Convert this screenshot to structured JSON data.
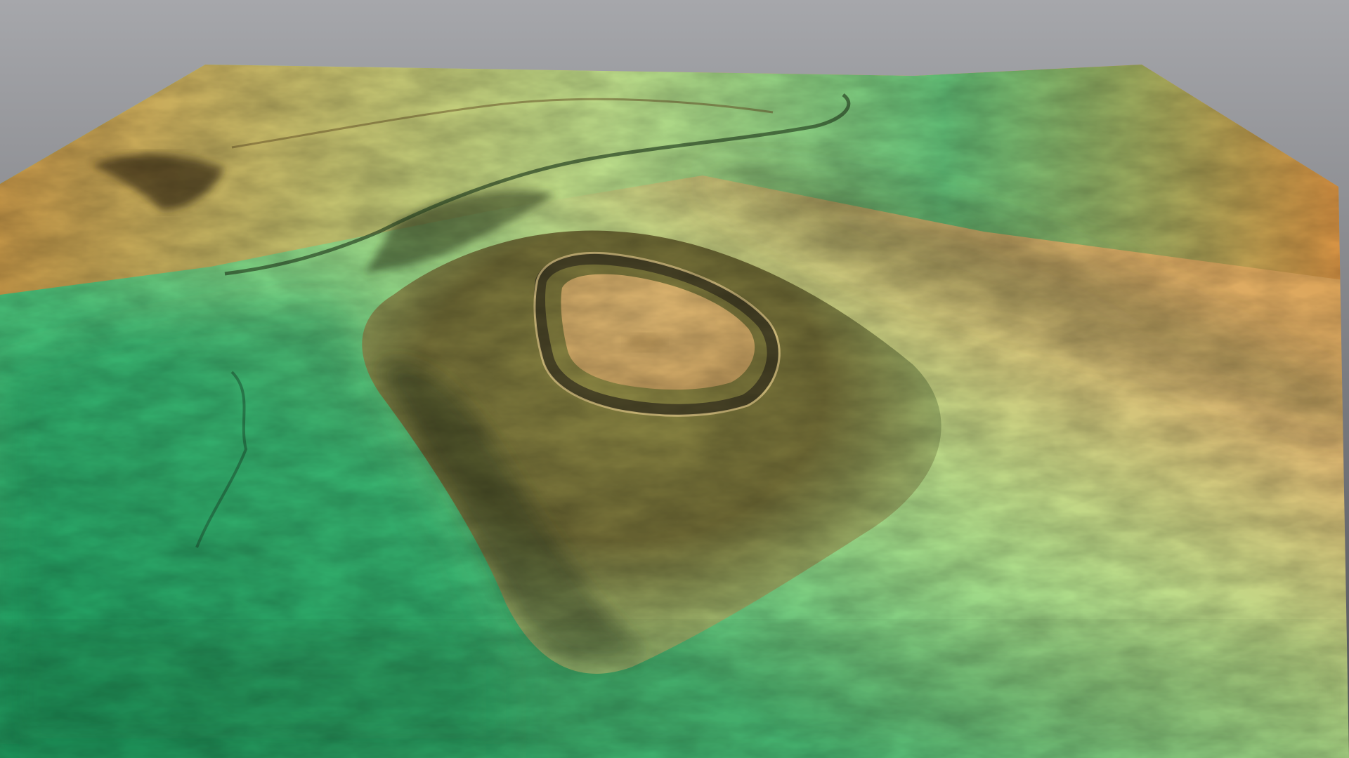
{
  "scene": {
    "background_top": "#a6a7ab",
    "background_bottom": "#4f5156",
    "palette": {
      "low_green": "#1f9a5f",
      "mid_green": "#4cc27a",
      "pale_green": "#b9e08c",
      "olive": "#8f8a45",
      "tan": "#e0b872",
      "high_orange": "#d98f3f",
      "shadow": "#2e3b22"
    },
    "features": [
      "hillfort-enclosure",
      "hill-mound",
      "ridge",
      "stream-channel",
      "valley-floor"
    ]
  }
}
